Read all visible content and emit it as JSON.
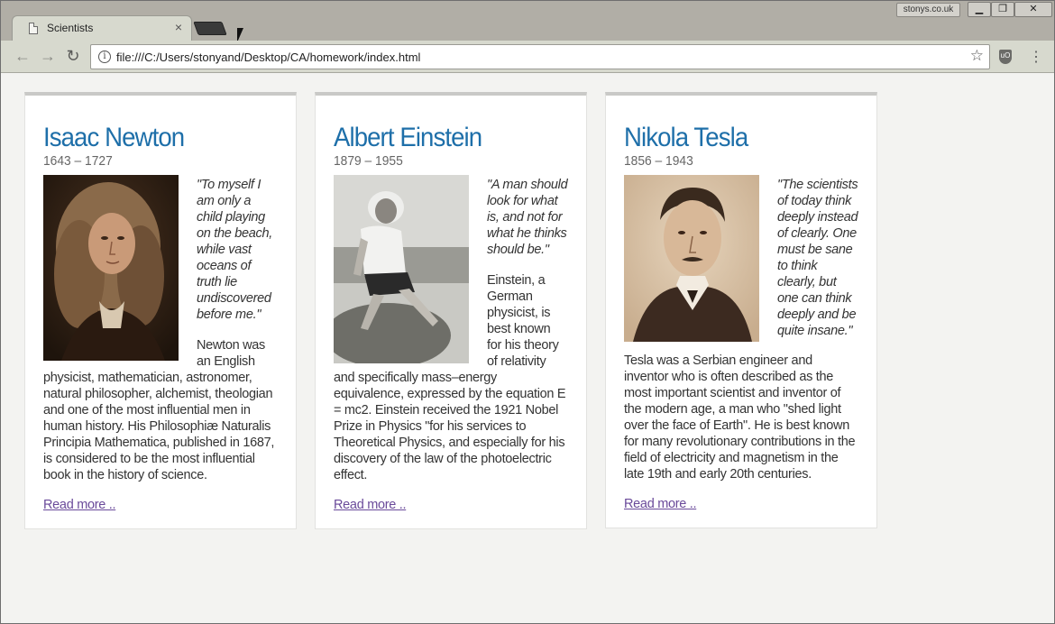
{
  "browser": {
    "tab_title": "Scientists",
    "tab_close": "×",
    "profile_name": "stonys.co.uk",
    "window_min": "▁",
    "window_max": "❐",
    "window_close": "✕",
    "url": "file:///C:/Users/stonyand/Desktop/CA/homework/index.html",
    "back_icon": "←",
    "forward_icon": "→",
    "reload_icon": "↻",
    "info_icon": "i",
    "star_icon": "☆",
    "menu_icon": "⋮",
    "extension_label": "uO"
  },
  "colors": {
    "heading": "#1e6fa9",
    "link": "#6a4a9a"
  },
  "scientists": [
    {
      "name": "Isaac Newton",
      "dates": "1643 – 1727",
      "quote": "\"To myself I am only a child playing on the beach, while vast oceans of truth lie undiscovered before me.\"",
      "bio": "Newton was an English physicist, mathematician, astronomer, natural philosopher, alchemist, theologian and one of the most influential men in human history. His Philosophiæ Naturalis Principia Mathematica, published in 1687, is considered to be the most influential book in the history of science.",
      "read_more": "Read more .."
    },
    {
      "name": "Albert Einstein",
      "dates": "1879 – 1955",
      "quote": "\"A man should look for what is, and not for what he thinks should be.\"",
      "bio": "Einstein, a German physicist, is best known for his theory of relativity and specifically mass–energy equivalence, expressed by the equation E = mc2. Einstein received the 1921 Nobel Prize in Physics \"for his services to Theoretical Physics, and especially for his discovery of the law of the photoelectric effect.",
      "read_more": "Read more .."
    },
    {
      "name": "Nikola Tesla",
      "dates": "1856 – 1943",
      "quote": "\"The scientists of today think deeply instead of clearly. One must be sane to think clearly, but one can think deeply and be quite insane.\"",
      "bio": "Tesla was a Serbian engineer and inventor who is often described as the most important scientist and inventor of the modern age, a man who \"shed light over the face of Earth\". He is best known for many revolutionary contributions in the field of electricity and magnetism in the late 19th and early 20th centuries.",
      "read_more": "Read more .."
    }
  ]
}
